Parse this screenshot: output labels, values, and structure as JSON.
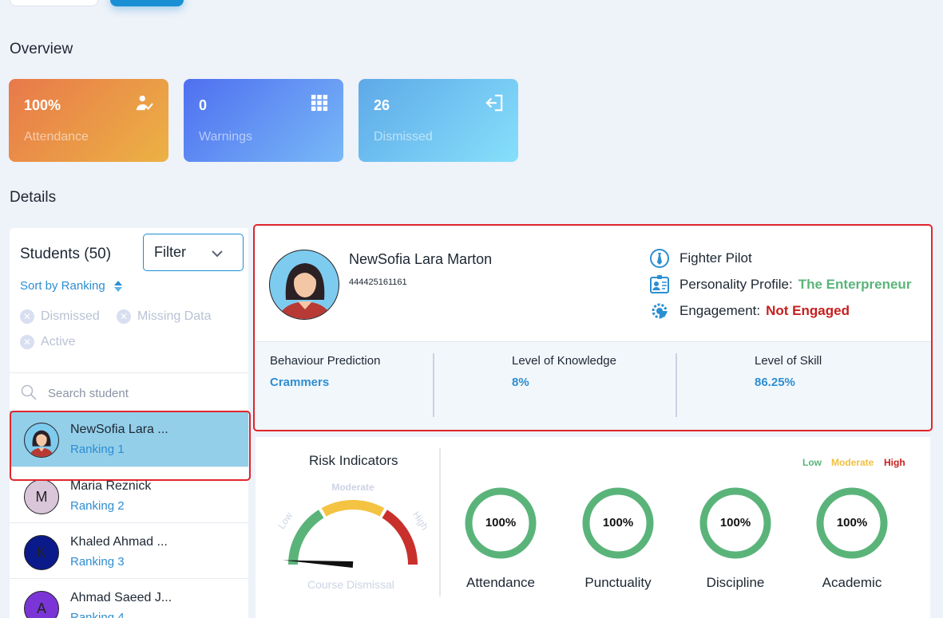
{
  "overview": {
    "title": "Overview",
    "cards": [
      {
        "value": "100%",
        "label": "Attendance",
        "icon": "user-check-icon"
      },
      {
        "value": "0",
        "label": "Warnings",
        "icon": "grid-icon"
      },
      {
        "value": "26",
        "label": "Dismissed",
        "icon": "exit-icon"
      }
    ]
  },
  "details": {
    "title": "Details"
  },
  "students": {
    "title": "Students (50)",
    "filter_label": "Filter",
    "sort_label": "Sort by Ranking",
    "chips": [
      "Dismissed",
      "Missing Data",
      "Active"
    ],
    "search_placeholder": "Search student",
    "list": [
      {
        "name": "NewSofia Lara ...",
        "rank": "Ranking 1",
        "initial": "",
        "avatar_color": "#7ecbf0"
      },
      {
        "name": "Maria Reznick",
        "rank": "Ranking 2",
        "initial": "M",
        "avatar_color": "#d9c6d9"
      },
      {
        "name": "Khaled Ahmad ...",
        "rank": "Ranking 3",
        "initial": "K",
        "avatar_color": "#0a1a8a"
      },
      {
        "name": "Ahmad Saeed J...",
        "rank": "Ranking 4",
        "initial": "A",
        "avatar_color": "#7b35d6"
      }
    ]
  },
  "profile": {
    "name": "NewSofia Lara Marton",
    "id": "444425161161",
    "career": "Fighter Pilot",
    "personality_label": "Personality Profile:",
    "personality_value": "The Enterpreneur",
    "engagement_label": "Engagement:",
    "engagement_value": "Not Engaged",
    "metrics": [
      {
        "label": "Behaviour Prediction",
        "value": "Crammers"
      },
      {
        "label": "Level of Knowledge",
        "value": "8%"
      },
      {
        "label": "Level of Skill",
        "value": "86.25%"
      }
    ]
  },
  "risk": {
    "title": "Risk Indicators",
    "gauge_labels": {
      "low": "Low",
      "moderate": "Moderate",
      "high": "High"
    },
    "gauge_caption": "Course Dismissal",
    "gauge_level": 0.02,
    "legend": {
      "low": "Low",
      "moderate": "Moderate",
      "high": "High"
    },
    "indicators": [
      {
        "label": "Attendance",
        "value": "100%",
        "level": 1.0
      },
      {
        "label": "Punctuality",
        "value": "100%",
        "level": 1.0
      },
      {
        "label": "Discipline",
        "value": "100%",
        "level": 1.0
      },
      {
        "label": "Academic",
        "value": "100%",
        "level": 1.0
      }
    ],
    "colors": {
      "low": "#5ab47a",
      "moderate": "#f4c342",
      "high": "#c8302c"
    }
  }
}
